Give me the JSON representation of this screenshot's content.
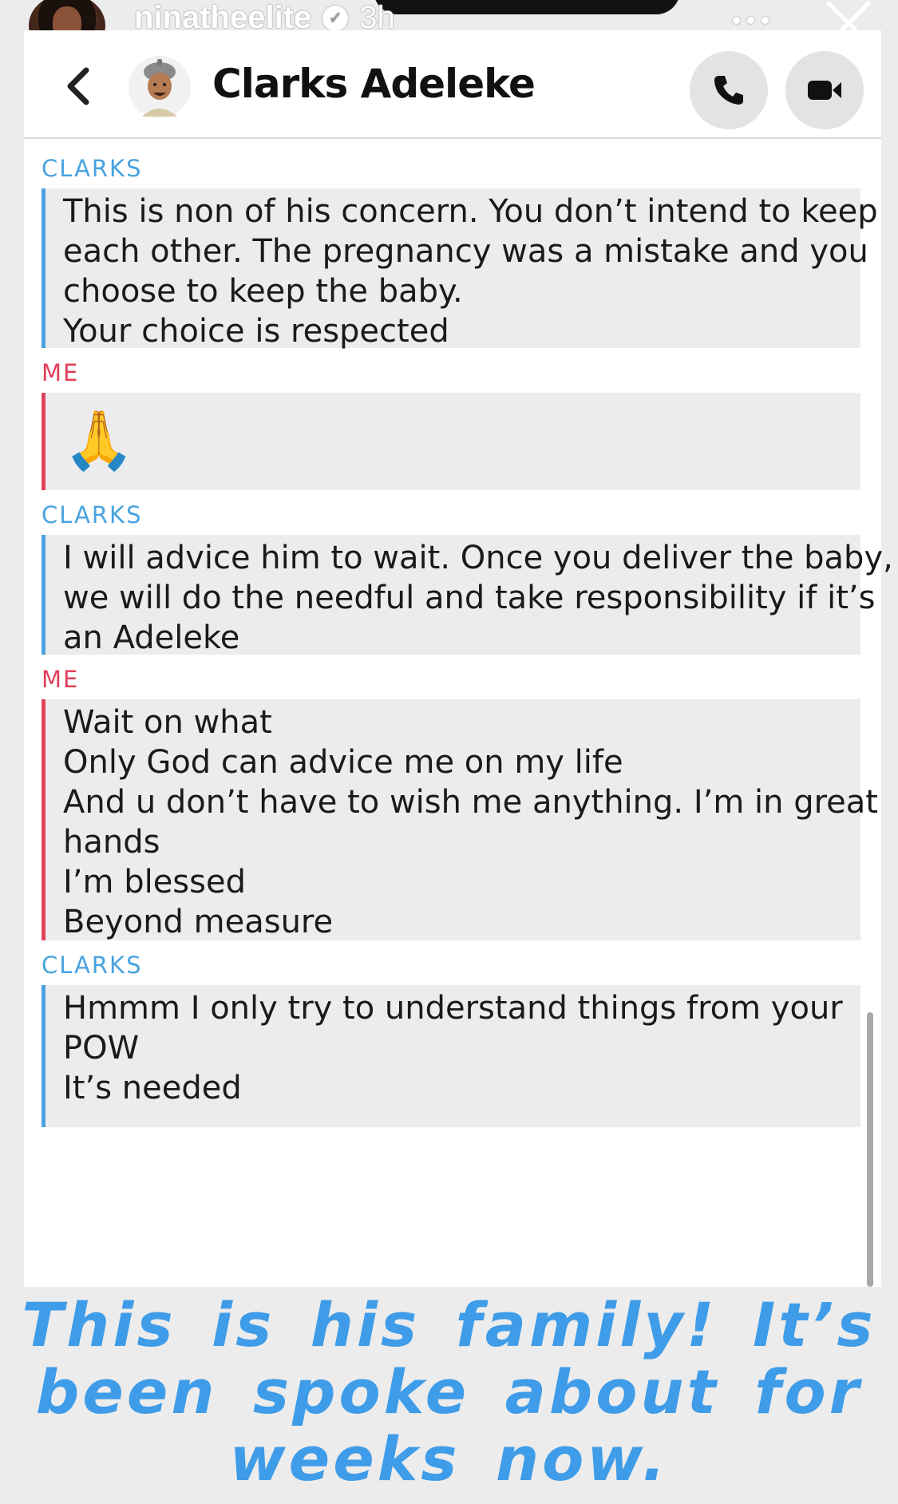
{
  "story": {
    "username": "ninatheelite",
    "time": "3h"
  },
  "chat": {
    "contact_name": "Clarks Adeleke",
    "messages": [
      {
        "sender": "CLARKS",
        "lines": [
          "This is non of his concern. You don’t intend to keep",
          "each other. The pregnancy was a mistake and you",
          "choose to keep the baby.",
          "Your choice is respected"
        ]
      },
      {
        "sender": "ME",
        "emoji": "🙏"
      },
      {
        "sender": "CLARKS",
        "lines": [
          "I will advice him to wait. Once you deliver the baby,",
          "we will do the needful and take responsibility if it’s",
          "an Adeleke"
        ]
      },
      {
        "sender": "ME",
        "lines": [
          "Wait on what",
          "Only God can advice me on my life",
          "And u don’t have to wish me anything. I’m in great",
          "hands",
          "I’m blessed",
          "Beyond measure"
        ]
      },
      {
        "sender": "CLARKS",
        "lines": [
          "Hmmm I only try to understand things from your",
          "POW",
          "It’s needed"
        ]
      }
    ]
  },
  "caption": {
    "lines": [
      "This is his family! It’s",
      "been spoke about for",
      "weeks now."
    ]
  },
  "colors": {
    "clarks_accent": "#4aa3df",
    "me_accent": "#e0415b",
    "caption": "#3e9ce8",
    "bubble_bg": "#ececee"
  }
}
